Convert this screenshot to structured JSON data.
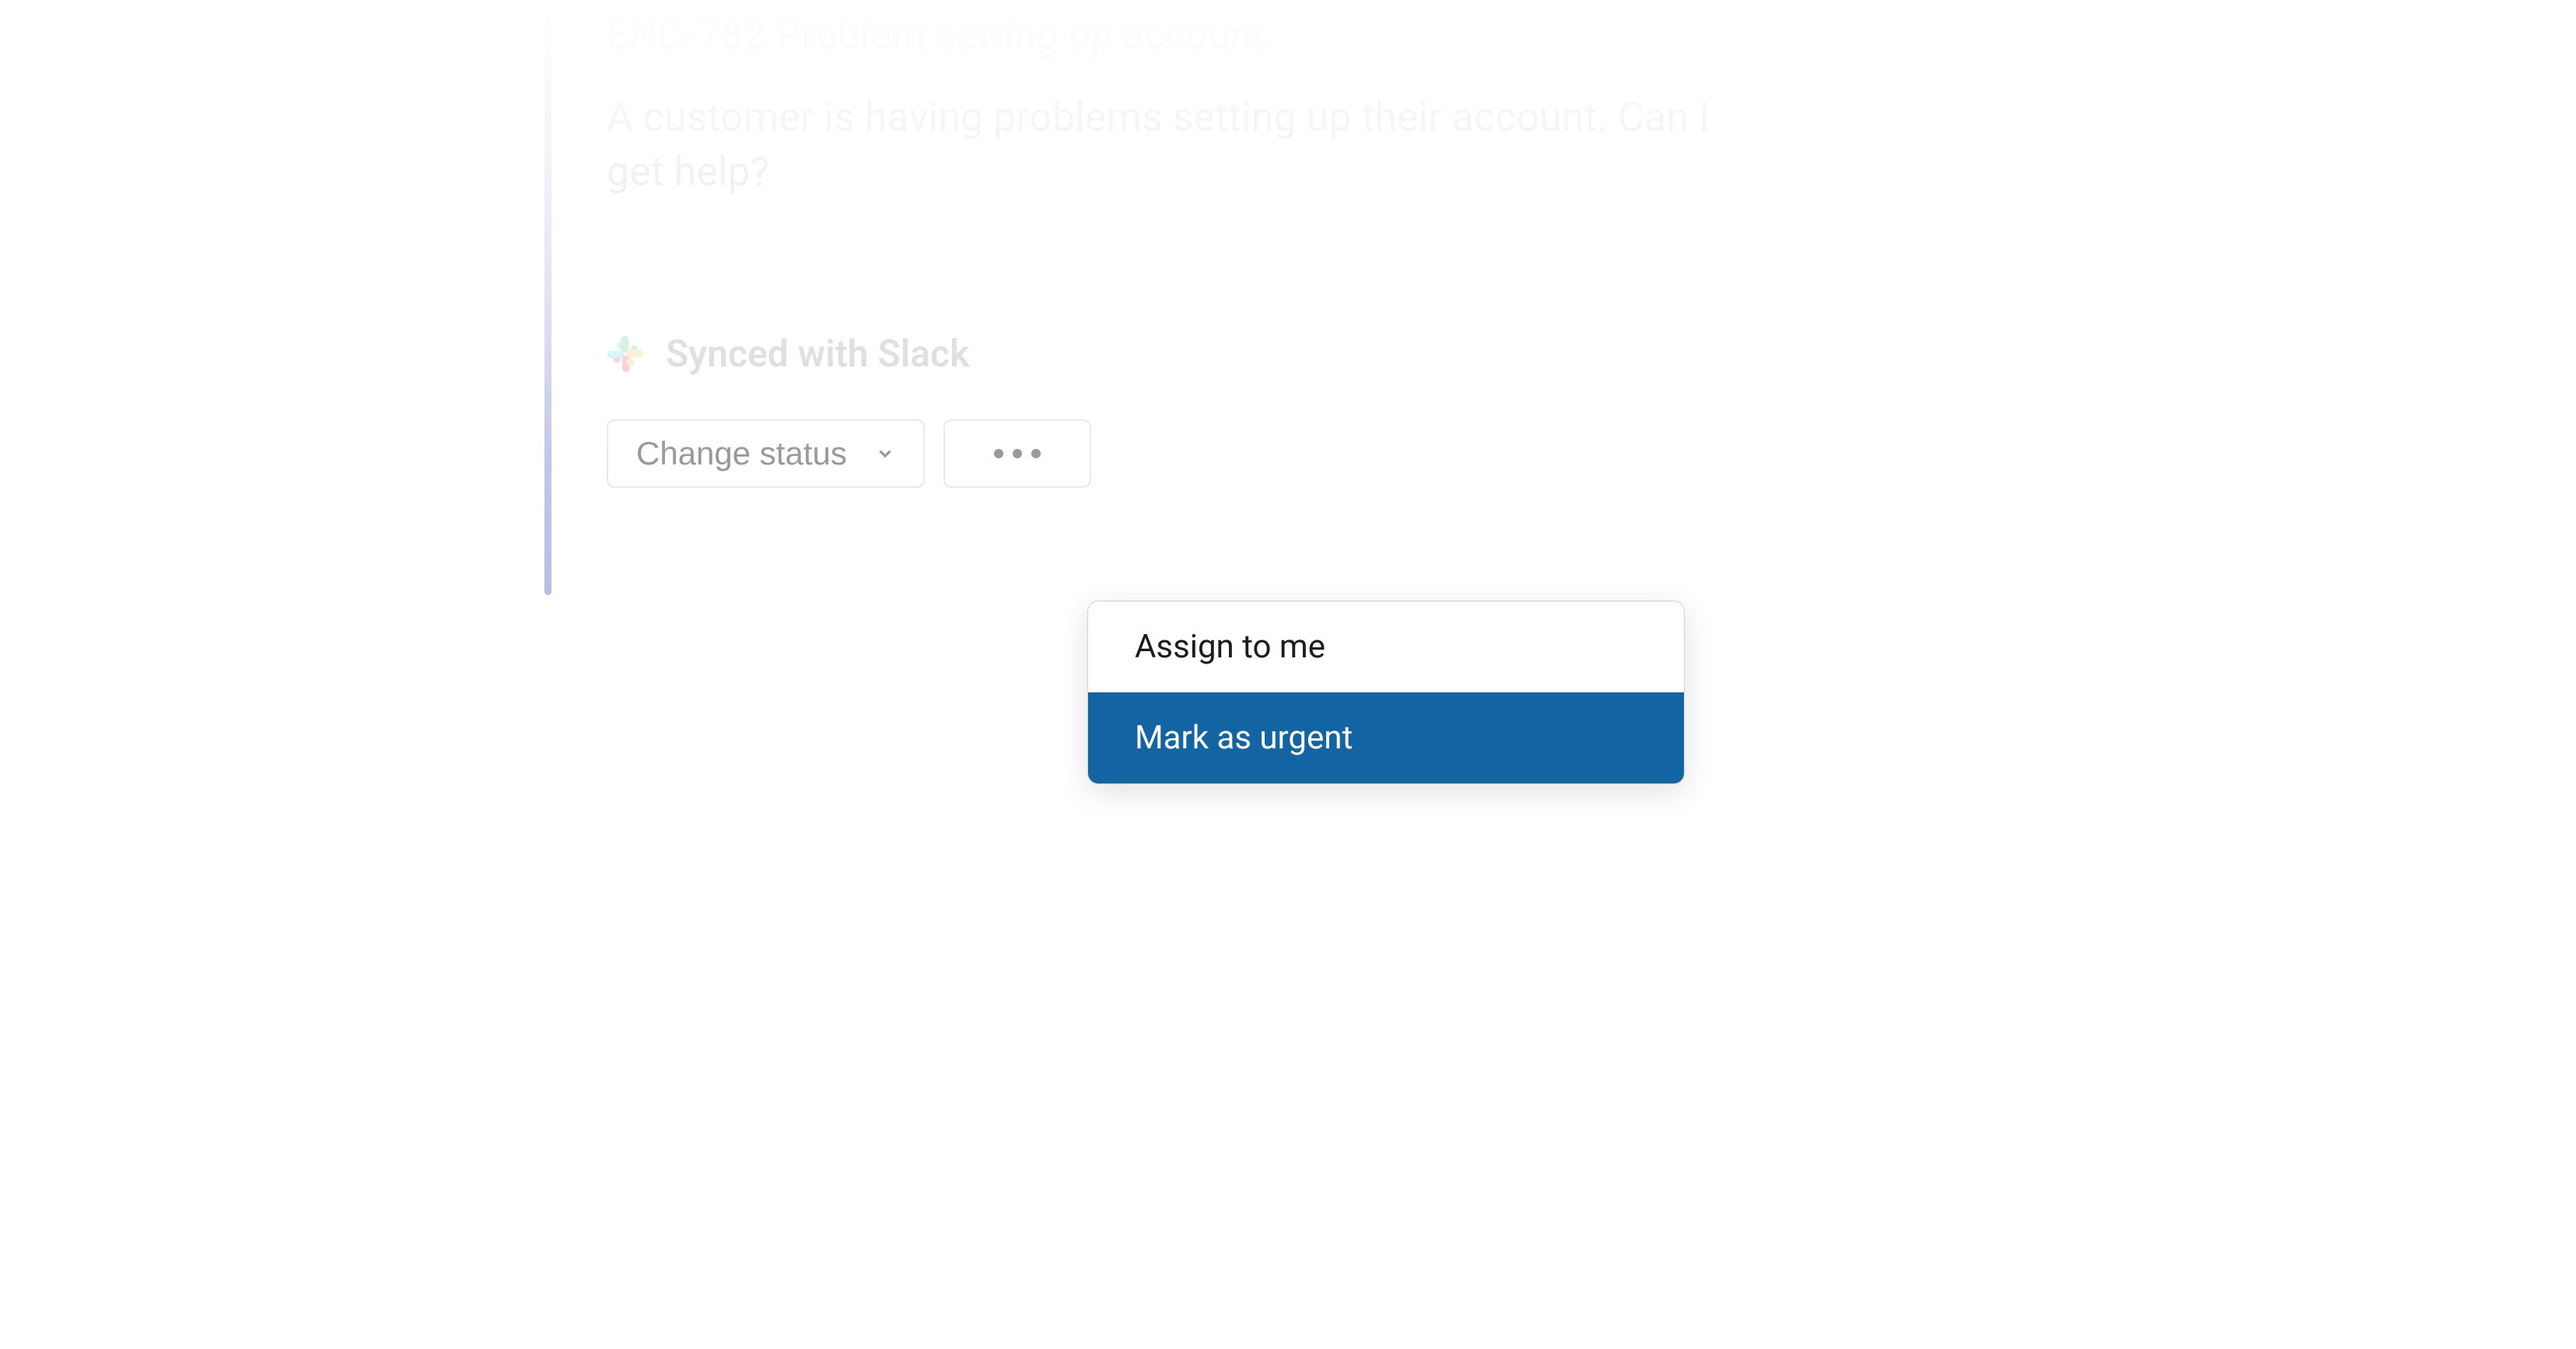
{
  "ticket": {
    "title": "ENC-782 Problem setting up account",
    "description": "A customer is having problems setting up their account. Can I get help?"
  },
  "synced": {
    "label": "Synced with Slack"
  },
  "actions": {
    "change_status_label": "Change status"
  },
  "menu": {
    "items": [
      {
        "label": "Assign to me",
        "highlighted": false
      },
      {
        "label": "Mark as urgent",
        "highlighted": true
      }
    ]
  }
}
